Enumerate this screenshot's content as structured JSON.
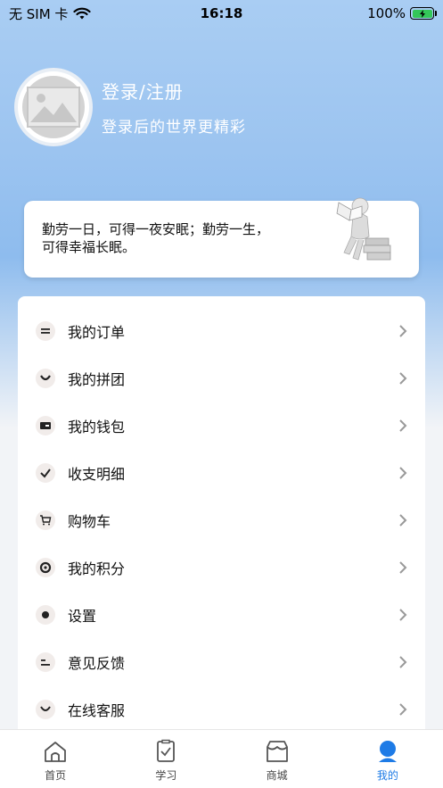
{
  "status_bar": {
    "carrier": "无 SIM 卡",
    "time": "16:18",
    "battery": "100%"
  },
  "profile": {
    "login_label": "登录/注册",
    "subtitle": "登录后的世界更精彩",
    "avatar_icon": "image-placeholder-icon"
  },
  "quote": {
    "line1": "勤劳一日，可得一夜安眠；勤劳一生，",
    "line2": "可得幸福长眠。"
  },
  "menu": {
    "items": [
      {
        "label": "我的订单",
        "icon": "order-icon"
      },
      {
        "label": "我的拼团",
        "icon": "group-buy-icon"
      },
      {
        "label": "我的钱包",
        "icon": "wallet-icon"
      },
      {
        "label": "收支明细",
        "icon": "checkmark-icon"
      },
      {
        "label": "购物车",
        "icon": "cart-icon"
      },
      {
        "label": "我的积分",
        "icon": "points-icon"
      },
      {
        "label": "设置",
        "icon": "settings-icon"
      },
      {
        "label": "意见反馈",
        "icon": "feedback-icon"
      },
      {
        "label": "在线客服",
        "icon": "customer-service-icon"
      }
    ]
  },
  "tabbar": {
    "tabs": [
      {
        "label": "首页",
        "icon": "home-icon"
      },
      {
        "label": "学习",
        "icon": "study-icon"
      },
      {
        "label": "商城",
        "icon": "shop-icon"
      },
      {
        "label": "我的",
        "icon": "profile-icon"
      }
    ],
    "active": "我的"
  },
  "colors": {
    "accent": "#1e7be6",
    "header_gradient_top": "#a9cdf3",
    "battery_green": "#34c759"
  }
}
